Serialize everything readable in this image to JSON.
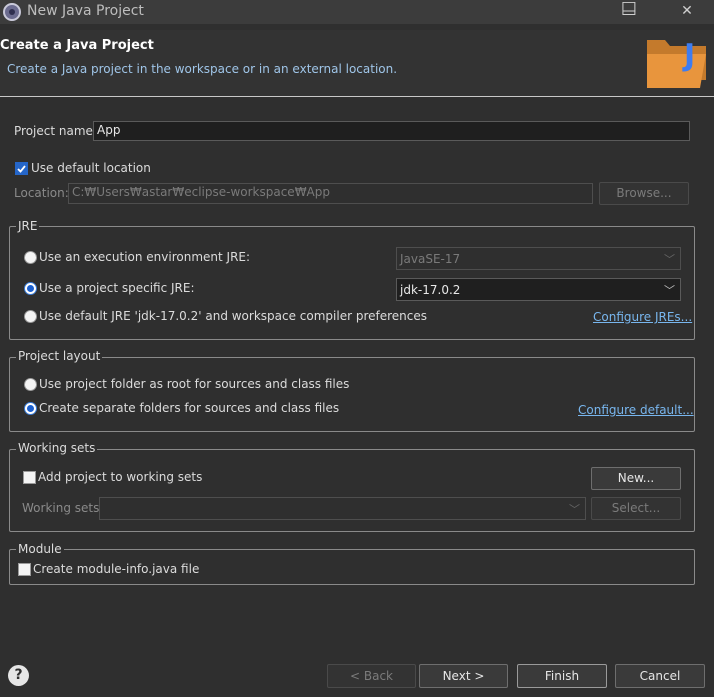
{
  "window": {
    "title": "New Java Project",
    "minimize_icon": "minimize-icon",
    "maximize_icon": "maximize-icon",
    "close_icon": "close-icon",
    "minimize_glyph": "—",
    "maximize_glyph": "☐",
    "close_glyph": "✕"
  },
  "header": {
    "title": "Create a Java Project",
    "description": "Create a Java project in the workspace or in an external location.",
    "wizard_icon": "java-project-folder-icon",
    "wizard_icon_letter": "J"
  },
  "project": {
    "name_label": "Project name:",
    "name_value": "App",
    "use_default_location_label": "Use default location",
    "use_default_location_checked": true,
    "location_label": "Location:",
    "location_value": "C:₩Users₩astar₩eclipse-workspace₩App",
    "browse_label": "Browse..."
  },
  "jre": {
    "group_title": "JRE",
    "option_env_label": "Use an execution environment JRE:",
    "option_env_value": "JavaSE-17",
    "option_specific_label": "Use a project specific JRE:",
    "option_specific_value": "jdk-17.0.2",
    "option_default_label": "Use default JRE 'jdk-17.0.2' and workspace compiler preferences",
    "configure_link": "Configure JREs...",
    "selected": "specific"
  },
  "layout": {
    "group_title": "Project layout",
    "option_root_label": "Use project folder as root for sources and class files",
    "option_separate_label": "Create separate folders for sources and class files",
    "configure_link": "Configure default...",
    "selected": "separate"
  },
  "working_sets": {
    "group_title": "Working sets",
    "add_label": "Add project to working sets",
    "add_checked": false,
    "new_button": "New...",
    "sets_label": "Working sets:",
    "select_button": "Select..."
  },
  "module": {
    "group_title": "Module",
    "create_label": "Create module-info.java file",
    "create_checked": false
  },
  "footer": {
    "help_icon": "help-icon",
    "help_glyph": "?",
    "back_label": "< Back",
    "next_label": "Next >",
    "finish_label": "Finish",
    "cancel_label": "Cancel"
  },
  "colors": {
    "accent": "#1a5fd0",
    "link": "#78b6ee",
    "background": "#2f2f2f"
  }
}
